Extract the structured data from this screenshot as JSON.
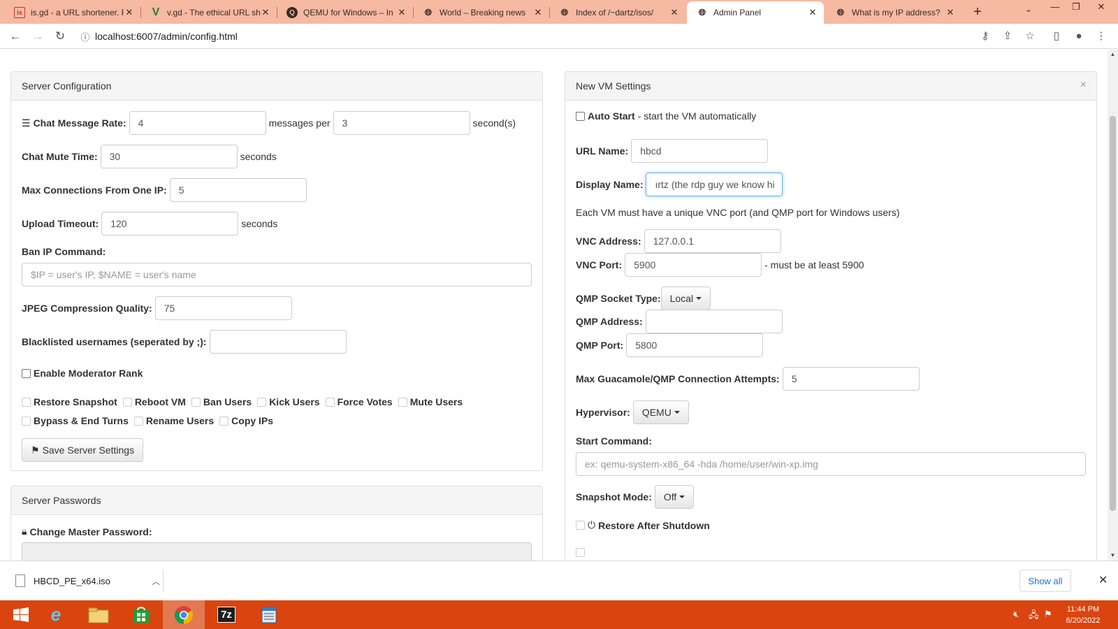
{
  "browser": {
    "tabs": [
      {
        "title": "is.gd - a URL shortener. F",
        "icon": "isgd-favicon"
      },
      {
        "title": "v.gd - The ethical URL sh",
        "icon": "vgd-favicon"
      },
      {
        "title": "QEMU for Windows – In",
        "icon": "qemu-favicon"
      },
      {
        "title": "World – Breaking news",
        "icon": "globe-favicon"
      },
      {
        "title": "Index of /~dartz/isos/",
        "icon": "globe-favicon"
      },
      {
        "title": "Admin Panel",
        "icon": "globe-favicon"
      },
      {
        "title": "What is my IP address?",
        "icon": "globe-favicon"
      }
    ],
    "active_tab": 5,
    "url": "localhost:6007/admin/config.html",
    "accent": "#f6b9a2"
  },
  "server_config": {
    "title": "Server Configuration",
    "chat_rate_label": "Chat Message Rate:",
    "chat_rate_messages": "4",
    "messages_per": "messages per",
    "chat_rate_seconds": "3",
    "seconds_paren": "second(s)",
    "mute_label": "Chat Mute Time:",
    "mute_value": "30",
    "seconds": "seconds",
    "maxconn_label": "Max Connections From One IP:",
    "maxconn_value": "5",
    "upload_label": "Upload Timeout:",
    "upload_value": "120",
    "ban_label": "Ban IP Command:",
    "ban_placeholder": "$IP = user's IP, $NAME = user's name",
    "jpeg_label": "JPEG Compression Quality:",
    "jpeg_value": "75",
    "blacklist_label": "Blacklisted usernames (seperated by ;):",
    "blacklist_value": "",
    "mod_label": "Enable Moderator Rank",
    "perms": [
      "Restore Snapshot",
      "Reboot VM",
      "Ban Users",
      "Kick Users",
      "Force Votes",
      "Mute Users",
      "Bypass & End Turns",
      "Rename Users",
      "Copy IPs"
    ],
    "save_label": "Save Server Settings"
  },
  "passwords": {
    "title": "Server Passwords",
    "master_label": "Change Master Password:"
  },
  "vm_settings": {
    "title": "New VM Settings",
    "close": "×",
    "autostart_label": "Auto Start",
    "autostart_desc": "- start the VM automatically",
    "url_label": "URL Name:",
    "url_value": "hbcd",
    "display_label": "Display Name:",
    "display_value": "ırtz (the rdp guy we know hi",
    "vnc_note": "Each VM must have a unique VNC port (and QMP port for Windows users)",
    "vnc_addr_label": "VNC Address:",
    "vnc_addr_value": "127.0.0.1",
    "vnc_port_label": "VNC Port:",
    "vnc_port_value": "5900",
    "vnc_port_note": "- must be at least 5900",
    "qmp_type_label": "QMP Socket Type:",
    "qmp_type_value": "Local",
    "qmp_addr_label": "QMP Address:",
    "qmp_addr_value": "",
    "qmp_port_label": "QMP Port:",
    "qmp_port_value": "5800",
    "max_attempts_label": "Max Guacamole/QMP Connection Attempts:",
    "max_attempts_value": "5",
    "hypervisor_label": "Hypervisor:",
    "hypervisor_value": "QEMU",
    "start_cmd_label": "Start Command:",
    "start_cmd_placeholder": "ex: qemu-system-x86_64 -hda /home/user/win-xp.img",
    "snapshot_label": "Snapshot Mode:",
    "snapshot_value": "Off",
    "restore_label": "Restore After Shutdown"
  },
  "downloads": {
    "file": "HBCD_PE_x64.iso",
    "show_all": "Show all"
  },
  "taskbar": {
    "time": "11:44 PM",
    "date": "6/20/2022",
    "color": "#d9440f"
  }
}
